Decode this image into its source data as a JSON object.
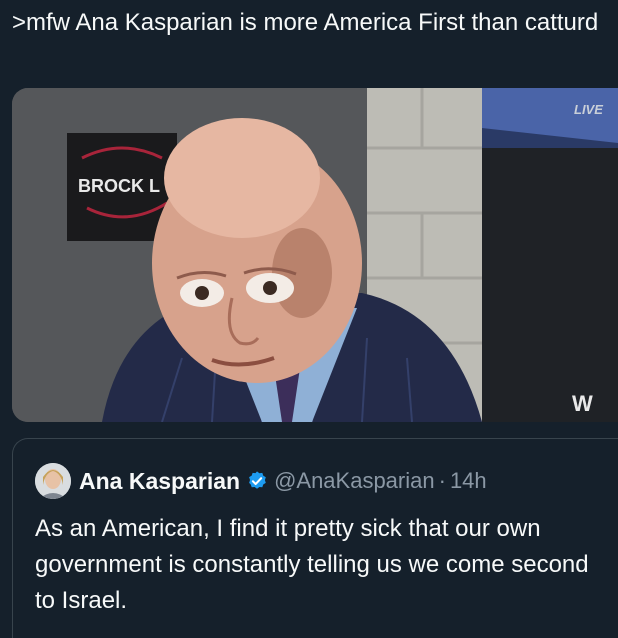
{
  "post": {
    "text": ">mfw Ana Kasparian is more America First than catturd"
  },
  "media": {
    "sign_text": "BROCK L",
    "live_badge": "LIVE",
    "watermark": "W"
  },
  "quote": {
    "author_name": "Ana Kasparian",
    "handle": "@AnaKasparian",
    "separator": "·",
    "time": "14h",
    "text": "As an American, I find it pretty sick that our own government is constantly telling us we come second to Israel.",
    "verified_color": "#1d9bf0"
  },
  "icons": {
    "verified": "verified-badge-icon",
    "avatar": "avatar"
  }
}
